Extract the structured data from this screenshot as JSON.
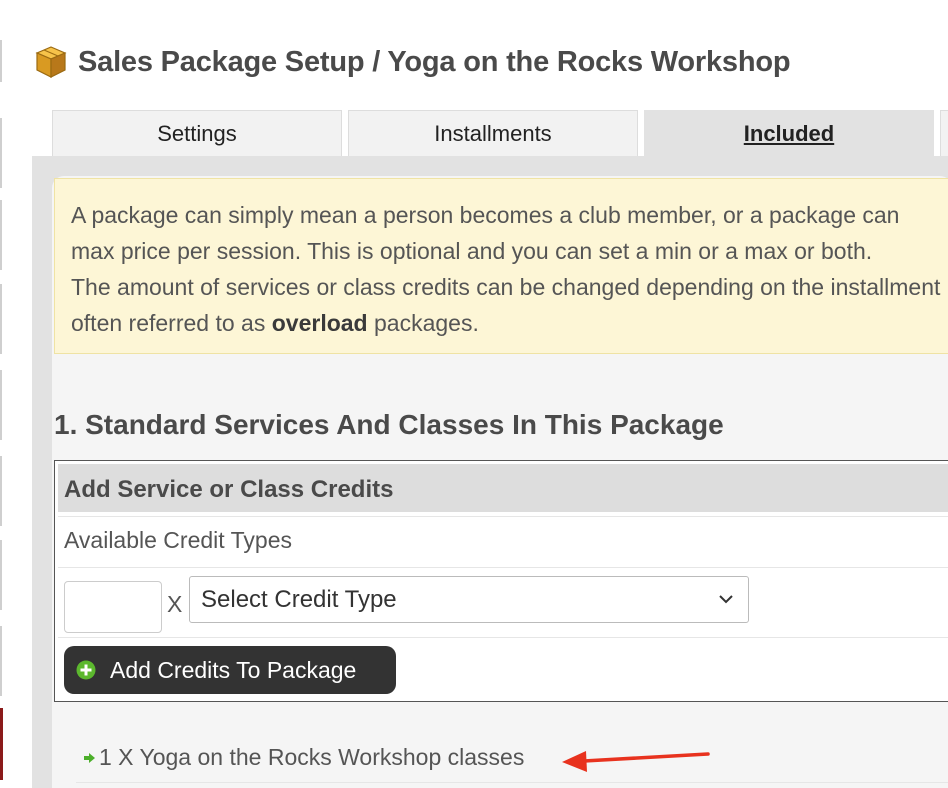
{
  "page": {
    "title": "Sales Package Setup / Yoga on the Rocks Workshop"
  },
  "tabs": [
    {
      "label": "Settings",
      "active": false
    },
    {
      "label": "Installments",
      "active": false
    },
    {
      "label": "Included",
      "active": true
    }
  ],
  "notice": {
    "line1": "A package can simply mean a person becomes a club member, or a package can",
    "line2": "max price per session. This is optional and you can set a min or a max or both.",
    "line3": "The amount of services or class credits can be changed depending on the installment",
    "line4_before": "often referred to as ",
    "line4_bold": "overload",
    "line4_after": " packages."
  },
  "section": {
    "title": "1. Standard Services And Classes In This Package"
  },
  "credits": {
    "header": "Add Service or Class Credits",
    "available_label": "Available Credit Types",
    "quantity_value": "",
    "multiplier": "X",
    "select_value": "Select Credit Type",
    "add_button_label": "Add Credits To Package"
  },
  "included_items": [
    {
      "text": "1 X Yoga on the Rocks Workshop classes"
    }
  ],
  "colors": {
    "notice_bg": "#fdf6d6",
    "button_bg": "#333333",
    "annotation_arrow": "#e8321e",
    "plus_icon": "#5cb82e"
  },
  "icons": {
    "header": "package-box-icon",
    "select": "chevron-down-icon",
    "button": "plus-circle-icon",
    "item": "green-arrow-icon",
    "annotation": "red-arrow-icon"
  }
}
